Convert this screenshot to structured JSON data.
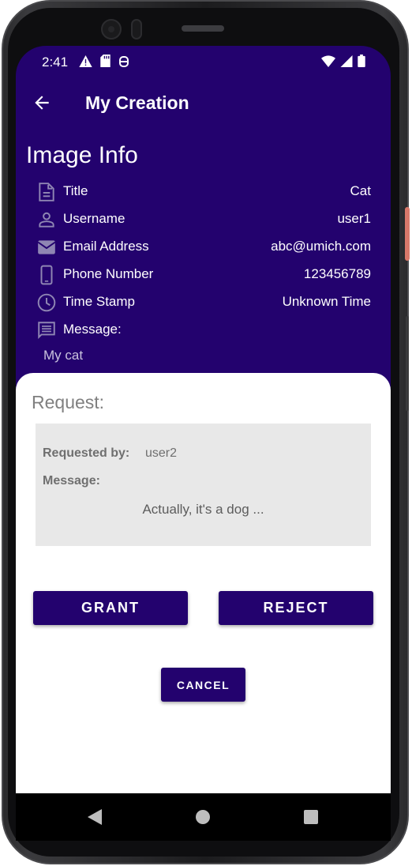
{
  "status_bar": {
    "time": "2:41"
  },
  "app_bar": {
    "title": "My Creation"
  },
  "image_info": {
    "heading": "Image Info",
    "rows": [
      {
        "label": "Title",
        "value": "Cat",
        "icon": "document-icon"
      },
      {
        "label": "Username",
        "value": "user1",
        "icon": "person-icon"
      },
      {
        "label": "Email Address",
        "value": "abc@umich.com",
        "icon": "email-icon"
      },
      {
        "label": "Phone Number",
        "value": "123456789",
        "icon": "phone-icon"
      },
      {
        "label": "Time Stamp",
        "value": "Unknown Time",
        "icon": "clock-icon"
      },
      {
        "label": "Message:",
        "value": "",
        "icon": "message-icon"
      }
    ],
    "message": "My cat"
  },
  "request": {
    "heading": "Request:",
    "requested_by_label": "Requested by:",
    "requested_by_value": "user2",
    "message_label": "Message:",
    "message_value": "Actually, it's a dog ..."
  },
  "buttons": {
    "grant": "GRANT",
    "reject": "REJECT",
    "cancel": "CANCEL"
  },
  "colors": {
    "primary": "#23026e",
    "sheet_background": "#ffffff",
    "request_box": "#e8e8e8",
    "icon_tint": "#8f86b3"
  }
}
